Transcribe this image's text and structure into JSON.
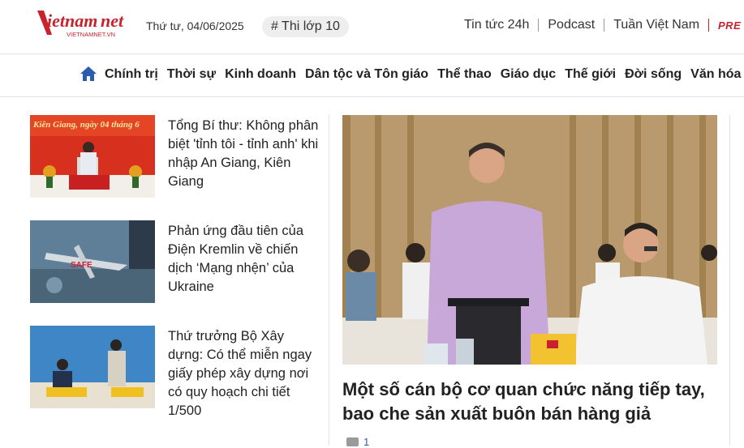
{
  "header": {
    "logo_text": "vietnamnet",
    "logo_sub": "VIETNAMNET.VN",
    "date": "Thứ tư, 04/06/2025",
    "hashtag": "# Thi lớp 10",
    "links": [
      "Tin tức 24h",
      "Podcast",
      "Tuần Việt Nam"
    ],
    "premium": "PRE"
  },
  "nav": {
    "items": [
      "Chính trị",
      "Thời sự",
      "Kinh doanh",
      "Dân tộc và Tôn giáo",
      "Thể thao",
      "Giáo dục",
      "Thế giới",
      "Đời sống",
      "Văn hóa -"
    ]
  },
  "articles": [
    {
      "title": "Tổng Bí thư: Không phân biệt 'tỉnh tôi - tỉnh anh' khi nhập An Giang, Kiên Giang",
      "thumb_caption": "Kiên Giang, ngày 04 tháng 6"
    },
    {
      "title": "Phản ứng đầu tiên của Điện Kremlin về chiến dịch ‘Mạng nhện’ của Ukraine",
      "thumb_caption": "SAFE"
    },
    {
      "title": "Thứ trưởng Bộ Xây dựng: Có thể miễn ngay giấy phép xây dựng nơi có quy hoạch chi tiết 1/500",
      "thumb_caption": ""
    }
  ],
  "featured": {
    "title": "Một số cán bộ cơ quan chức năng tiếp tay, bao che sản xuất buôn bán hàng giả",
    "comment_count": "1"
  },
  "colors": {
    "brand_red": "#c8232c",
    "nav_blue": "#2a5db0"
  }
}
